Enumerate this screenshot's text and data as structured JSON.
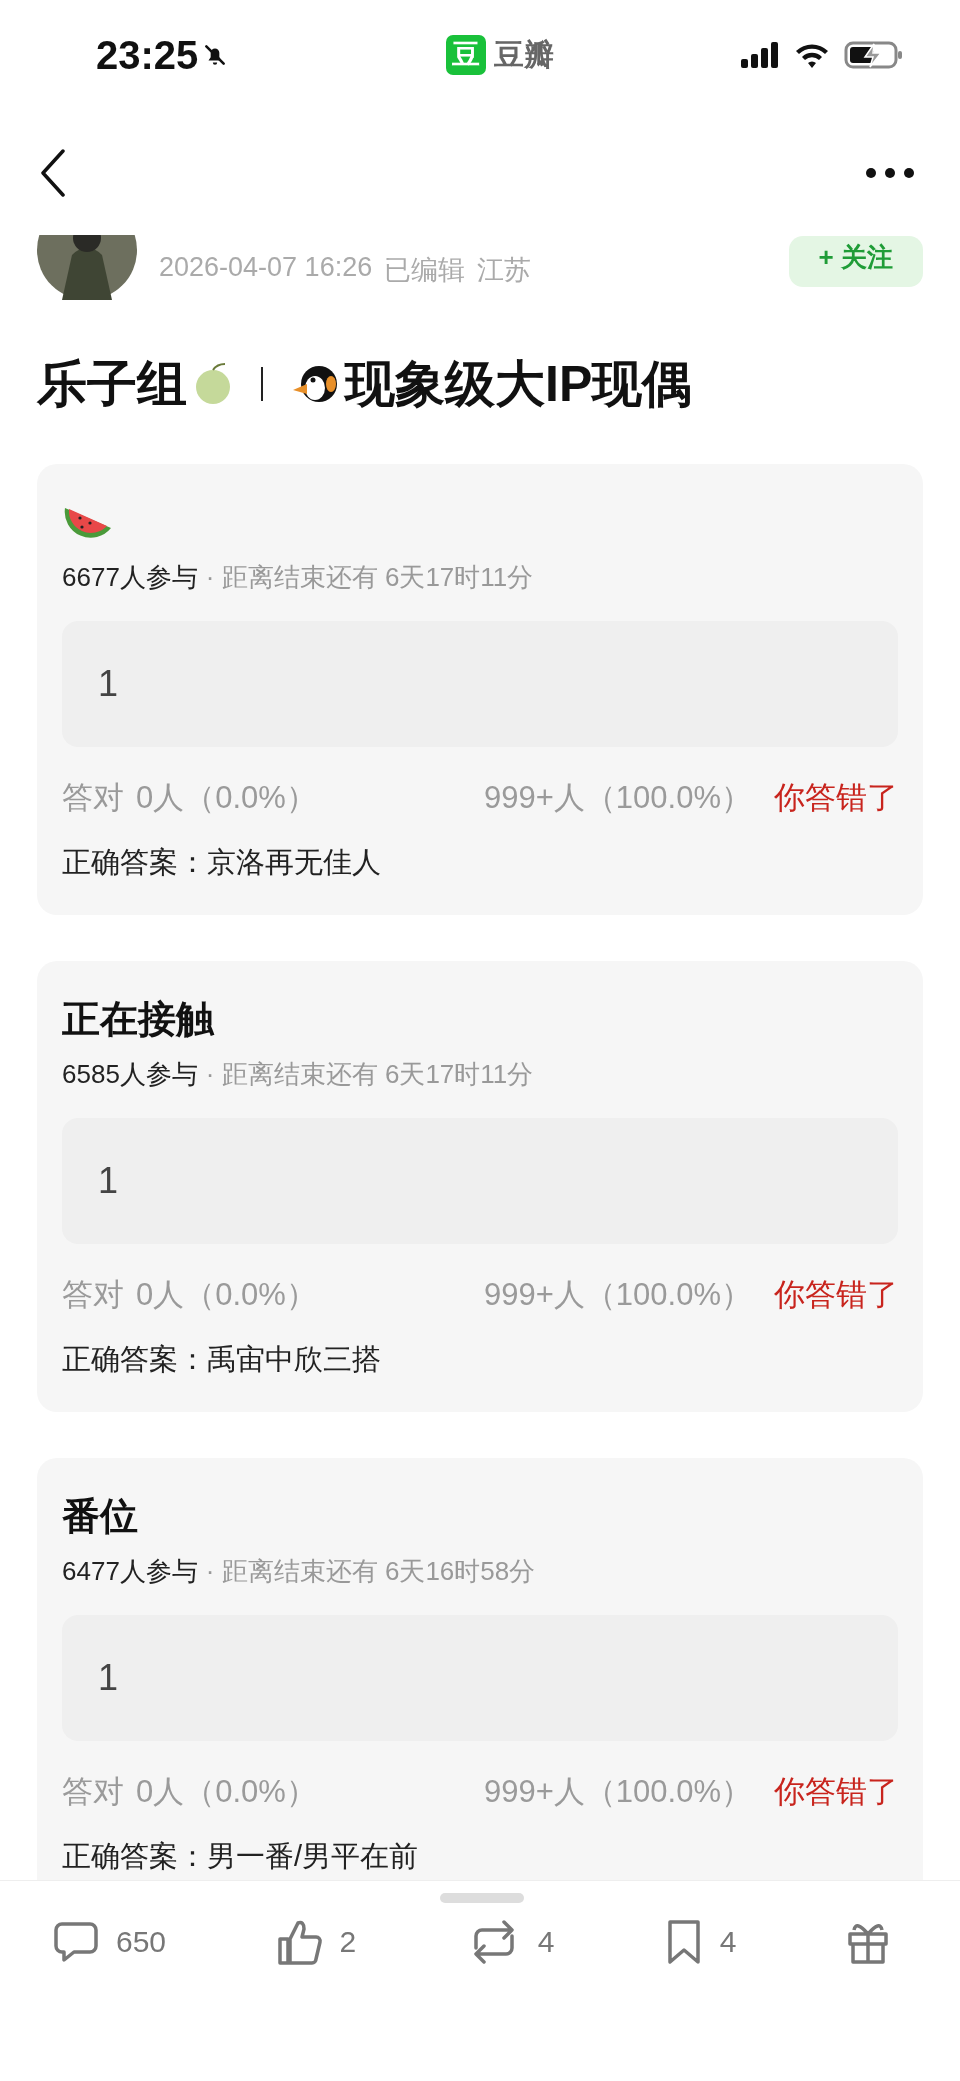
{
  "status_bar": {
    "time": "23:25",
    "app_logo": "豆",
    "app_name": "豆瓣"
  },
  "author": {
    "date": "2026-04-07 16:26",
    "edited": "已编辑",
    "location": "江苏",
    "follow": "+ 关注"
  },
  "title": {
    "left": "乐子组",
    "right": "现象级大IP现偶"
  },
  "quizzes": [
    {
      "heading": {
        "kind": "icon"
      },
      "participants": "6677人参与",
      "deadline": "· 距离结束还有 6天17时11分",
      "answer": "1",
      "correct_label": "答对",
      "correct_count": "0人（0.0%）",
      "wrong_count": "999+人（100.0%）",
      "result": "你答错了",
      "solution": "正确答案：京洛再无佳人"
    },
    {
      "heading": {
        "kind": "text",
        "text": "正在接触"
      },
      "participants": "6585人参与",
      "deadline": "· 距离结束还有 6天17时11分",
      "answer": "1",
      "correct_label": "答对",
      "correct_count": "0人（0.0%）",
      "wrong_count": "999+人（100.0%）",
      "result": "你答错了",
      "solution": "正确答案：禹宙中欣三搭"
    },
    {
      "heading": {
        "kind": "text",
        "text": "番位"
      },
      "participants": "6477人参与",
      "deadline": "· 距离结束还有 6天16时58分",
      "answer": "1",
      "correct_label": "答对",
      "correct_count": "0人（0.0%）",
      "wrong_count": "999+人（100.0%）",
      "result": "你答错了",
      "solution": "正确答案：男一番/男平在前"
    }
  ],
  "actions": [
    {
      "kind": "comment",
      "count": "650"
    },
    {
      "kind": "like",
      "count": "2"
    },
    {
      "kind": "repost",
      "count": "4"
    },
    {
      "kind": "bookmark",
      "count": "4"
    },
    {
      "kind": "gift"
    }
  ]
}
